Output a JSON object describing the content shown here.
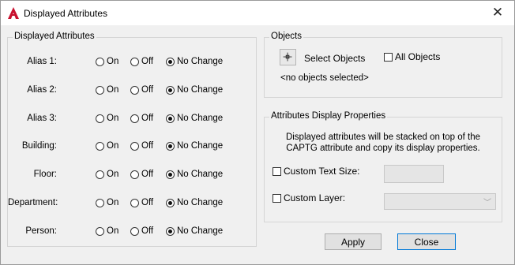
{
  "window": {
    "title": "Displayed Attributes"
  },
  "left_group": {
    "title": "Displayed Attributes",
    "rows": [
      {
        "label": "Alias 1:",
        "selected": "No Change"
      },
      {
        "label": "Alias 2:",
        "selected": "No Change"
      },
      {
        "label": "Alias 3:",
        "selected": "No Change"
      },
      {
        "label": "Building:",
        "selected": "No Change"
      },
      {
        "label": "Floor:",
        "selected": "No Change"
      },
      {
        "label": "Department:",
        "selected": "No Change"
      },
      {
        "label": "Person:",
        "selected": "No Change"
      }
    ],
    "options": [
      "On",
      "Off",
      "No Change"
    ]
  },
  "objects_group": {
    "title": "Objects",
    "select_label": "Select Objects",
    "all_objects_label": "All Objects",
    "all_objects_checked": false,
    "status": "<no objects selected>"
  },
  "props_group": {
    "title": "Attributes Display Properties",
    "description_line1": "Displayed attributes will be stacked on top of the",
    "description_line2": "CAPTG attribute and copy its display properties.",
    "custom_text_size_label": "Custom Text Size:",
    "custom_text_size_checked": false,
    "custom_text_size_value": "",
    "custom_layer_label": "Custom Layer:",
    "custom_layer_checked": false,
    "custom_layer_value": ""
  },
  "buttons": {
    "apply": "Apply",
    "close": "Close"
  },
  "colors": {
    "accent": "#0078d7",
    "app_icon": "#c8102e"
  }
}
